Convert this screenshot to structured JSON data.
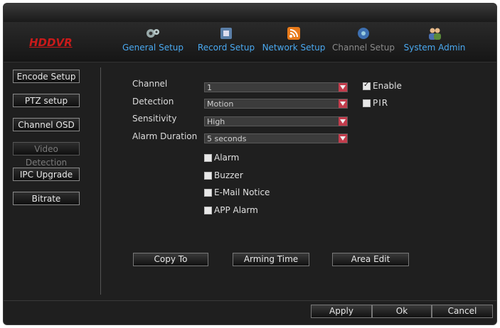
{
  "brand": "HDDVR",
  "tabs": [
    {
      "label": "General Setup",
      "icon": "gears-icon"
    },
    {
      "label": "Record Setup",
      "icon": "film-icon"
    },
    {
      "label": "Network Setup",
      "icon": "wifi-icon"
    },
    {
      "label": "Channel Setup",
      "icon": "camera-icon"
    },
    {
      "label": "System Admin",
      "icon": "users-icon"
    }
  ],
  "sidebar": {
    "items": [
      {
        "label": "Encode Setup"
      },
      {
        "label": "PTZ setup"
      },
      {
        "label": "Channel OSD"
      },
      {
        "label": "Video Detection",
        "active": true
      },
      {
        "label": "IPC Upgrade"
      },
      {
        "label": "Bitrate"
      }
    ]
  },
  "form": {
    "channel": {
      "label": "Channel",
      "value": "1"
    },
    "detection": {
      "label": "Detection",
      "value": "Motion"
    },
    "sensitivity": {
      "label": "Sensitivity",
      "value": "High"
    },
    "alarm_duration": {
      "label": "Alarm Duration",
      "value": "5 seconds"
    },
    "enable": {
      "label": "Enable",
      "checked": true
    },
    "pir": {
      "label": "PIR",
      "checked": false
    },
    "options": [
      {
        "label": "Alarm",
        "checked": false
      },
      {
        "label": "Buzzer",
        "checked": false
      },
      {
        "label": "E-Mail Notice",
        "checked": false
      },
      {
        "label": "APP Alarm",
        "checked": false
      }
    ]
  },
  "actions": {
    "copy_to": "Copy To",
    "arming_time": "Arming Time",
    "area_edit": "Area Edit"
  },
  "footer": {
    "apply": "Apply",
    "ok": "Ok",
    "cancel": "Cancel"
  },
  "colors": {
    "accent": "#4aa9f0",
    "brand": "#c91a1a",
    "dropdown_arrow": "#c23c4c"
  }
}
